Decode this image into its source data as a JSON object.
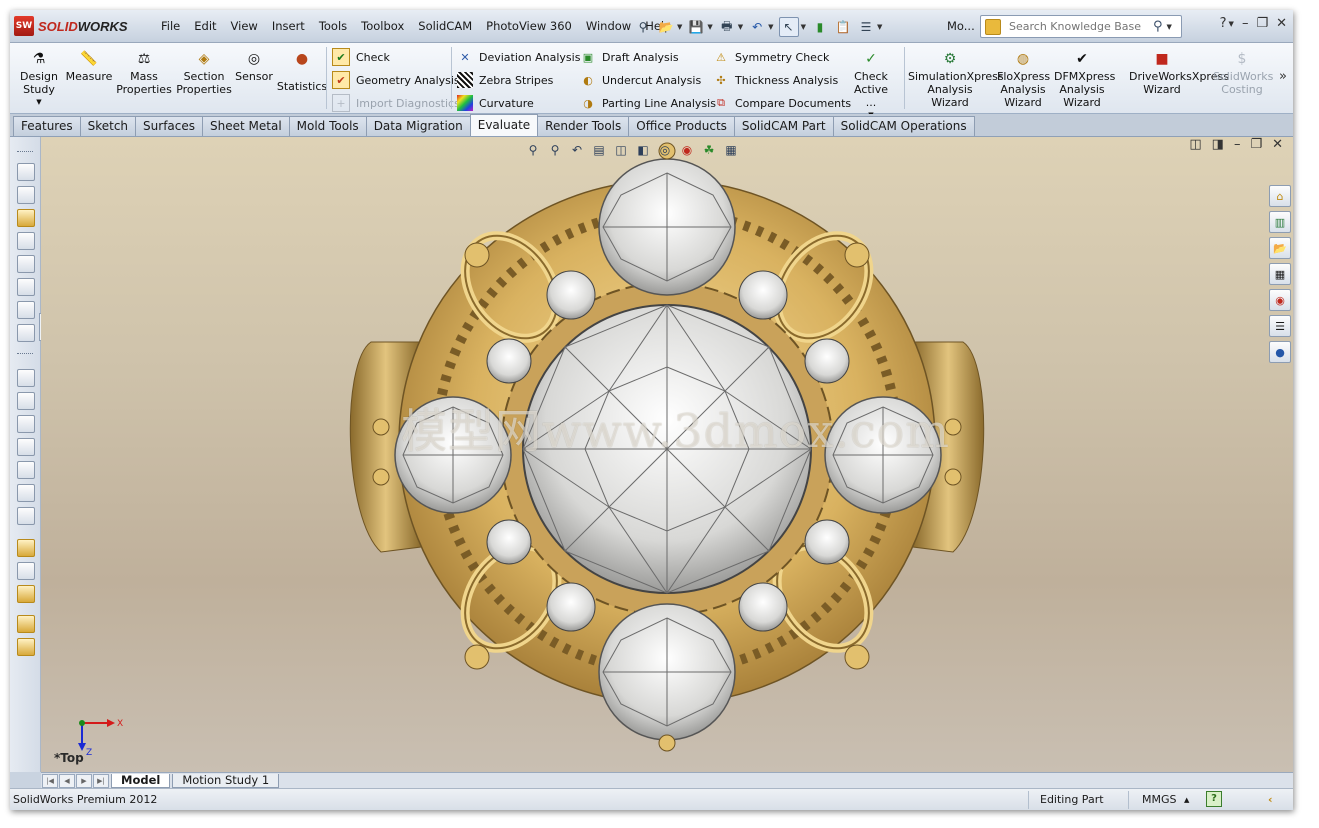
{
  "app": {
    "brand_prefix": "SOLID",
    "brand_suffix": "WORKS",
    "logo_letters": "SW"
  },
  "menu": [
    "File",
    "Edit",
    "View",
    "Insert",
    "Tools",
    "Toolbox",
    "SolidCAM",
    "PhotoView 360",
    "Window",
    "Help"
  ],
  "menu_overflow": "Mo...",
  "search": {
    "placeholder": "Search Knowledge Base"
  },
  "command_manager": {
    "big_buttons": [
      {
        "label": "Design Study",
        "icon": "design-study-icon",
        "enabled": true
      },
      {
        "label": "Measure",
        "icon": "measure-icon",
        "enabled": true
      },
      {
        "label": "Mass Properties",
        "icon": "mass-properties-icon",
        "enabled": true
      },
      {
        "label": "Section Properties",
        "icon": "section-properties-icon",
        "enabled": true
      },
      {
        "label": "Sensor",
        "icon": "sensor-icon",
        "enabled": true
      },
      {
        "label": "Statistics",
        "icon": "statistics-icon",
        "enabled": true
      }
    ],
    "check_group": [
      {
        "label": "Check",
        "icon": "check-icon",
        "enabled": true
      },
      {
        "label": "Geometry Analysis",
        "icon": "geometry-analysis-icon",
        "enabled": true
      },
      {
        "label": "Import Diagnostics",
        "icon": "import-diagnostics-icon",
        "enabled": false
      }
    ],
    "analysis_group_1": [
      {
        "label": "Deviation Analysis",
        "icon": "deviation-analysis-icon"
      },
      {
        "label": "Zebra Stripes",
        "icon": "zebra-stripes-icon"
      },
      {
        "label": "Curvature",
        "icon": "curvature-icon"
      }
    ],
    "analysis_group_2": [
      {
        "label": "Draft Analysis",
        "icon": "draft-analysis-icon"
      },
      {
        "label": "Undercut Analysis",
        "icon": "undercut-analysis-icon"
      },
      {
        "label": "Parting Line Analysis",
        "icon": "parting-line-analysis-icon"
      }
    ],
    "analysis_group_3": [
      {
        "label": "Symmetry Check",
        "icon": "symmetry-check-icon"
      },
      {
        "label": "Thickness Analysis",
        "icon": "thickness-analysis-icon"
      },
      {
        "label": "Compare Documents",
        "icon": "compare-documents-icon"
      }
    ],
    "check_active": {
      "label": "Check Active ..."
    },
    "wizards": [
      {
        "label": "SimulationXpress Analysis Wizard",
        "icon": "simulationxpress-icon",
        "enabled": true
      },
      {
        "label": "FloXpress Analysis Wizard",
        "icon": "floxpress-icon",
        "enabled": true
      },
      {
        "label": "DFMXpress Analysis Wizard",
        "icon": "dfmxpress-icon",
        "enabled": true
      },
      {
        "label": "DriveWorksXpress Wizard",
        "icon": "driveworksxpress-icon",
        "enabled": true
      },
      {
        "label": "SolidWorks Costing",
        "icon": "costing-icon",
        "enabled": false
      }
    ]
  },
  "tabs": [
    "Features",
    "Sketch",
    "Surfaces",
    "Sheet Metal",
    "Mold Tools",
    "Data Migration",
    "Evaluate",
    "Render Tools",
    "Office Products",
    "SolidCAM Part",
    "SolidCAM Operations"
  ],
  "active_tab": "Evaluate",
  "viewport": {
    "watermark": "模型网www.3dmox.com",
    "view_label": "*Top",
    "triad": {
      "x_label": "X",
      "z_label": "Z"
    }
  },
  "bottom_tabs": [
    "Model",
    "Motion Study 1"
  ],
  "status": {
    "left": "SolidWorks Premium 2012",
    "mode": "Editing Part",
    "units": "MMGS",
    "units_caret": "▲",
    "help": "?"
  }
}
